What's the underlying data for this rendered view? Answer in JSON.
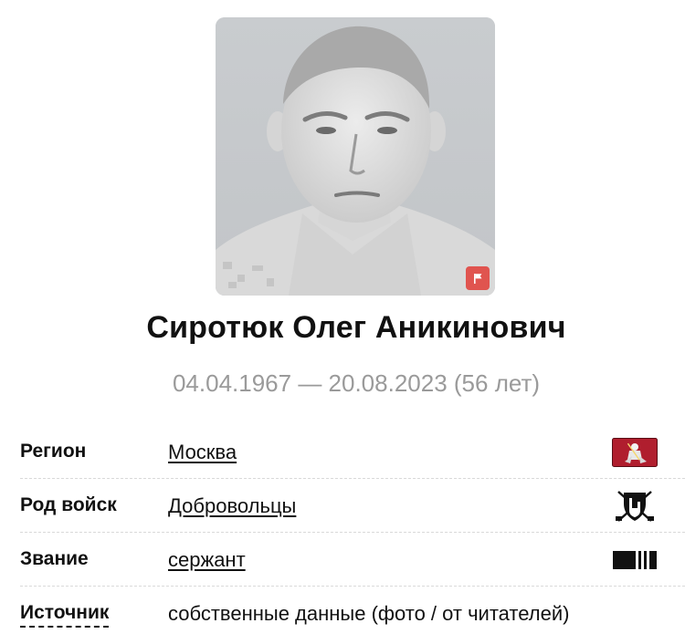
{
  "person": {
    "name": "Сиротюк Олег Аникинович",
    "dates": "04.04.1967 — 20.08.2023 (56 лет)"
  },
  "photo": {
    "portrait_icon": "portrait-photo",
    "badge_icon": "flag-icon",
    "badge_color": "#e0544f"
  },
  "info": {
    "region": {
      "label": "Регион",
      "value": "Москва",
      "icon": "moscow-coat-of-arms-icon"
    },
    "branch": {
      "label": "Род войск",
      "value": "Добровольцы",
      "icon": "shield-swords-icon"
    },
    "rank": {
      "label": "Звание",
      "value": "сержант",
      "icon": "sergeant-stripes-icon"
    },
    "source": {
      "label": "Источник",
      "value": "собственные данные (фото / от читателей)"
    }
  },
  "colors": {
    "text": "#111111",
    "muted": "#9a9a9a",
    "divider": "#d9d9d9",
    "moscow_red": "#b01e2e"
  }
}
